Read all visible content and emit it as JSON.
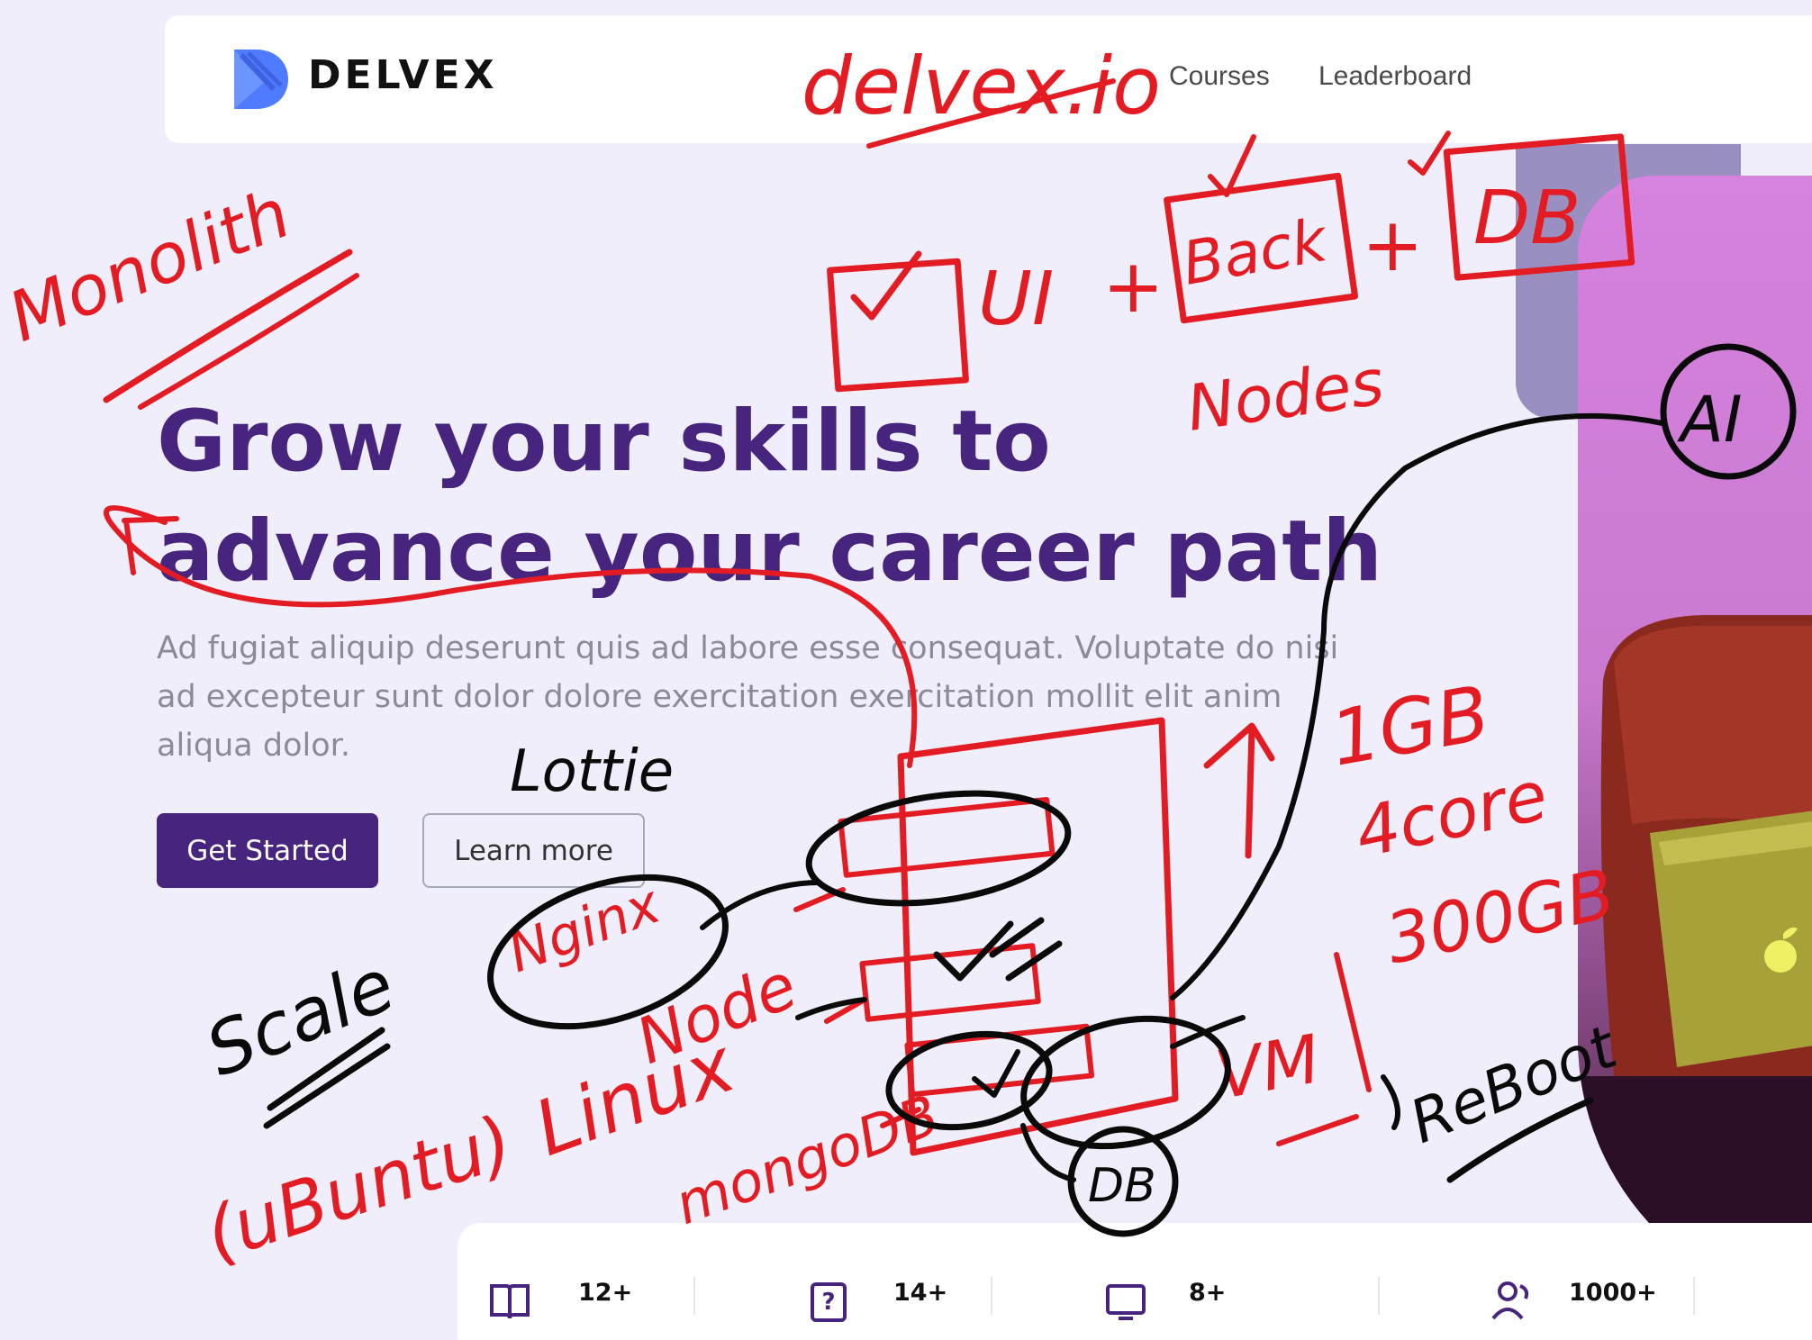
{
  "brand": {
    "name": "DELVEX"
  },
  "nav": {
    "links": [
      "Courses",
      "Leaderboard"
    ]
  },
  "hero": {
    "title_line1": "Grow your skills to",
    "title_line2": "advance your career path",
    "description": "Ad fugiat aliquip deserunt quis ad labore esse consequat. Voluptate do nisi ad excepteur sunt dolor dolore exercitation exercitation mollit elit anim aliqua dolor.",
    "cta_primary": "Get Started",
    "cta_secondary": "Learn more"
  },
  "stats": [
    {
      "value": "12+",
      "icon": "book-icon"
    },
    {
      "value": "14+",
      "icon": "quiz-icon"
    },
    {
      "value": "8+",
      "icon": "monitor-icon"
    },
    {
      "value": "1000+",
      "icon": "users-icon"
    }
  ],
  "annotations": {
    "red": [
      "delvex.io",
      "Monolith",
      "UI",
      "+",
      "Back",
      "+",
      "DB",
      "Nodes",
      "Nginx",
      "Node",
      "Linux",
      "(uBuntu)",
      "mongoDB",
      "VM",
      "1GB",
      "4core",
      "300GB"
    ],
    "black": [
      "AI",
      "Lottie",
      "Scale",
      "DB",
      "ReBoot"
    ]
  },
  "colors": {
    "primary": "#47257f",
    "background": "#f0eefa",
    "annotation_red": "#e31c23",
    "annotation_black": "#0a0a0a",
    "hero_image": "#d682df"
  }
}
